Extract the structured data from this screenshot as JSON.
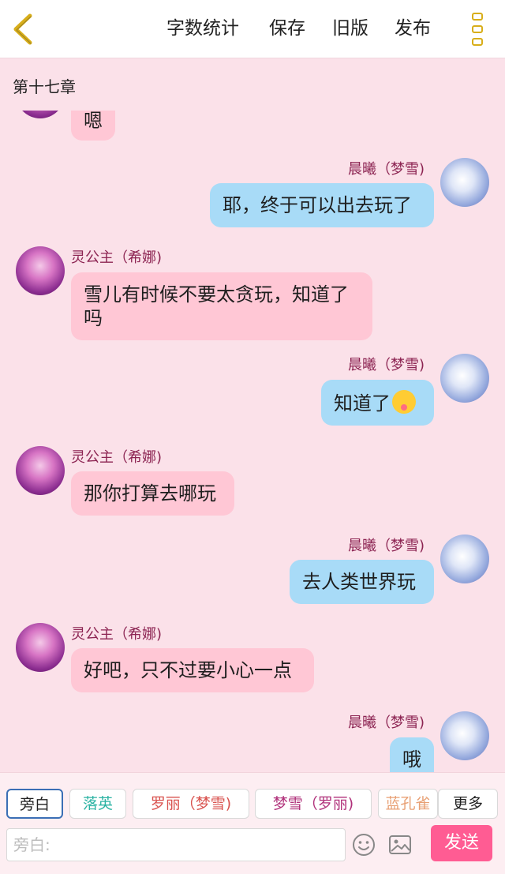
{
  "header": {
    "word_count": "字数统计",
    "save": "保存",
    "old_version": "旧版",
    "publish": "发布"
  },
  "chapter_title": "第十七章",
  "messages": [
    {
      "side": "left",
      "speaker": "",
      "text": "嗯"
    },
    {
      "side": "right",
      "speaker": "晨曦（梦雪)",
      "text": "耶，终于可以出去玩了"
    },
    {
      "side": "left",
      "speaker": "灵公主（希娜)",
      "text": "雪儿有时候不要太贪玩，知道了吗"
    },
    {
      "side": "right",
      "speaker": "晨曦（梦雪)",
      "text": "知道了",
      "emoji": "tongue-out-emoji"
    },
    {
      "side": "left",
      "speaker": "灵公主（希娜)",
      "text": "那你打算去哪玩"
    },
    {
      "side": "right",
      "speaker": "晨曦（梦雪)",
      "text": "去人类世界玩"
    },
    {
      "side": "left",
      "speaker": "灵公主（希娜)",
      "text": "好吧，只不过要小心一点"
    },
    {
      "side": "right",
      "speaker": "晨曦（梦雪)",
      "text": "哦"
    }
  ],
  "roles": [
    {
      "label": "旁白",
      "color": "#222222",
      "selected": true
    },
    {
      "label": "落英",
      "color": "#2bb3a3"
    },
    {
      "label": "罗丽（梦雪)",
      "color": "#d9534f"
    },
    {
      "label": "梦雪（罗丽)",
      "color": "#b0307a"
    },
    {
      "label": "蓝孔雀",
      "color": "#e8a074"
    }
  ],
  "more": "更多",
  "input": {
    "placeholder": "旁白:"
  },
  "send": "发送",
  "colors": {
    "accent": "#ff5c93",
    "background": "#fbe1e9",
    "left_bubble": "#ffc7d5",
    "right_bubble": "#a8dbf7",
    "name": "#8c2452"
  }
}
